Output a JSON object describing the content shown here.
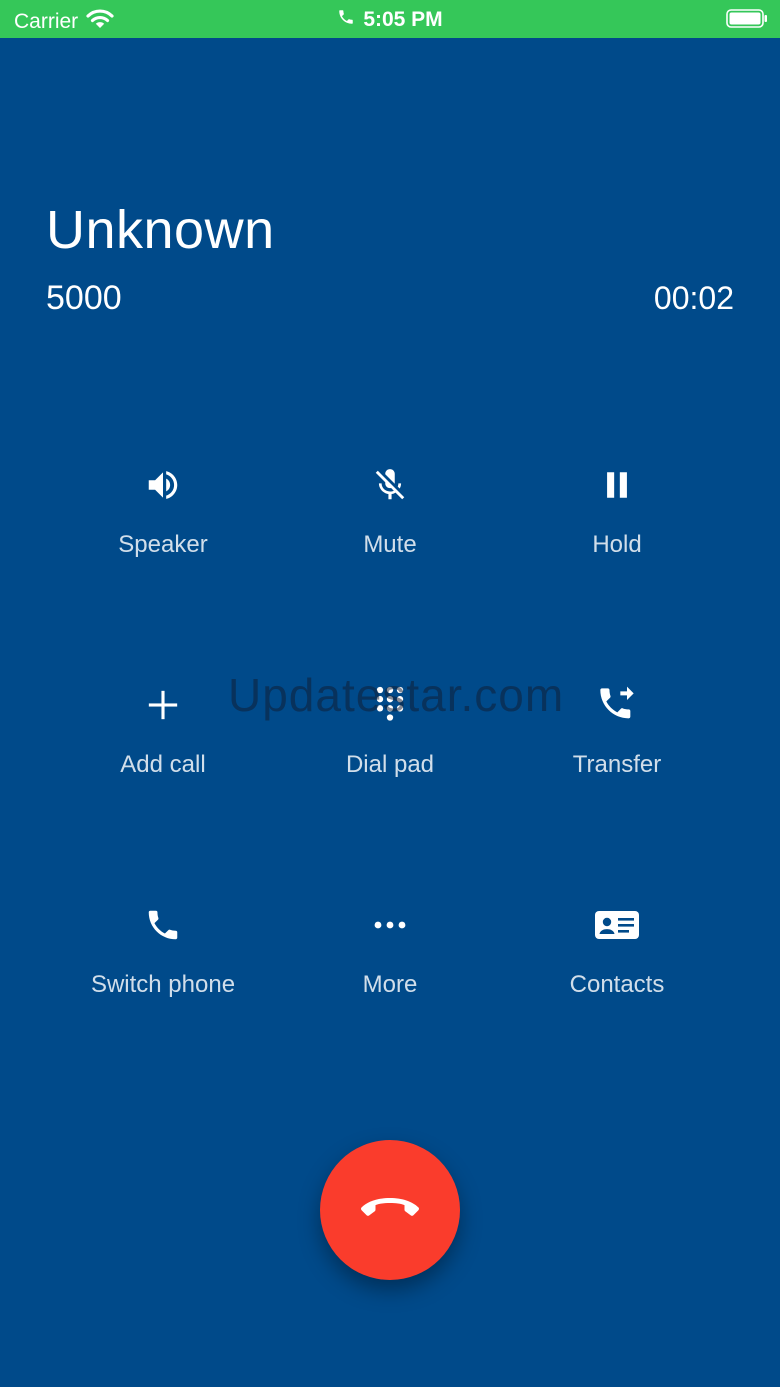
{
  "status_bar": {
    "carrier": "Carrier",
    "time": "5:05 PM",
    "color": "#35c759",
    "icons": [
      "wifi-icon",
      "phone-icon",
      "battery-icon"
    ]
  },
  "call": {
    "caller_name": "Unknown",
    "number": "5000",
    "duration": "00:02"
  },
  "controls": [
    {
      "label": "Speaker",
      "icon": "speaker-icon"
    },
    {
      "label": "Mute",
      "icon": "mic-off-icon"
    },
    {
      "label": "Hold",
      "icon": "pause-icon"
    },
    {
      "label": "Add call",
      "icon": "plus-icon"
    },
    {
      "label": "Dial pad",
      "icon": "dialpad-icon"
    },
    {
      "label": "Transfer",
      "icon": "phone-forward-icon"
    },
    {
      "label": "Switch phone",
      "icon": "phone-icon"
    },
    {
      "label": "More",
      "icon": "more-horizontal-icon"
    },
    {
      "label": "Contacts",
      "icon": "contact-card-icon"
    }
  ],
  "watermark": "Updatestar.com",
  "end_call": {
    "icon": "hang-up-icon",
    "color": "#fa3c2c"
  },
  "colors": {
    "background": "#004a8a",
    "accent": "#ffffff"
  }
}
